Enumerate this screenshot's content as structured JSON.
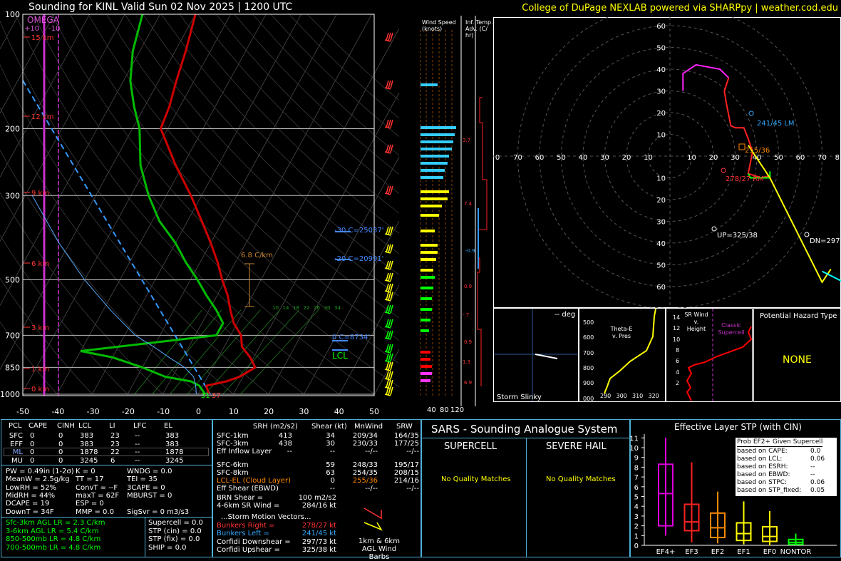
{
  "header": {
    "title": "Sounding for KINL Valid  Sun 02 Nov 2025 | 1200 UTC",
    "credit": "College of DuPage NEXLAB powered via SHARPpy | weather.cod.edu"
  },
  "skewt": {
    "omega_label": "OMEGA",
    "omega_scale": [
      "+10",
      "-10"
    ],
    "pressure_ticks": [
      "100",
      "200",
      "300",
      "500",
      "700",
      "850",
      "1000"
    ],
    "temp_ticks": [
      "-50",
      "-40",
      "-30",
      "-20",
      "-10",
      "0",
      "10",
      "20",
      "30",
      "40",
      "50"
    ],
    "height_labels": [
      "15 km",
      "12 km",
      "9 km",
      "6 km",
      "3 km",
      "1 km",
      "0 km"
    ],
    "lapse_label": "6.8 C/km",
    "levels": [
      "-30 C=25037'",
      "-20 C=20991'",
      "0 C=8734'"
    ],
    "lcl_label": "LCL",
    "sfc_td": "31",
    "sfc_t": "37",
    "mixing_ratio_labels": [
      "10",
      "14",
      "18",
      "22",
      "26",
      "30",
      "34"
    ]
  },
  "chart_data": [
    {
      "type": "line",
      "title": "Sounding for KINL Valid  Sun 02 Nov 2025 | 1200 UTC",
      "xlabel": "",
      "ylabel": "",
      "ylim": [
        1000,
        100
      ],
      "xlim": [
        -50,
        50
      ],
      "series": [
        {
          "name": "",
          "color": "#cc0000",
          "points": [
            [
              1000,
              3
            ],
            [
              950,
              1
            ],
            [
              925,
              6
            ],
            [
              900,
              9
            ],
            [
              850,
              12
            ],
            [
              800,
              9
            ],
            [
              750,
              5
            ],
            [
              700,
              3
            ],
            [
              650,
              -1
            ],
            [
              600,
              -4
            ],
            [
              550,
              -7
            ],
            [
              500,
              -11
            ],
            [
              450,
              -15
            ],
            [
              400,
              -20
            ],
            [
              350,
              -26
            ],
            [
              300,
              -33
            ],
            [
              250,
              -42
            ],
            [
              200,
              -52
            ],
            [
              175,
              -53
            ],
            [
              150,
              -55
            ],
            [
              125,
              -57
            ],
            [
              100,
              -60
            ]
          ]
        },
        {
          "name": "",
          "color": "#00bb00",
          "points": [
            [
              1000,
              2
            ],
            [
              950,
              -1
            ],
            [
              925,
              -4
            ],
            [
              900,
              -12
            ],
            [
              850,
              -20
            ],
            [
              800,
              -30
            ],
            [
              770,
              -40
            ],
            [
              700,
              -4
            ],
            [
              650,
              -4
            ],
            [
              600,
              -8
            ],
            [
              550,
              -13
            ],
            [
              500,
              -18
            ],
            [
              450,
              -24
            ],
            [
              400,
              -30
            ],
            [
              350,
              -38
            ],
            [
              300,
              -45
            ],
            [
              250,
              -52
            ],
            [
              200,
              -58
            ],
            [
              175,
              -63
            ],
            [
              150,
              -68
            ],
            [
              125,
              -72
            ],
            [
              100,
              -75
            ]
          ]
        },
        {
          "name": "",
          "color": "#55aaff",
          "points": [
            [
              1000,
              -0.5
            ],
            [
              950,
              -2
            ],
            [
              900,
              -4
            ],
            [
              850,
              -8
            ],
            [
              800,
              -14
            ],
            [
              750,
              -20
            ],
            [
              700,
              -27
            ],
            [
              600,
              -38
            ],
            [
              500,
              -50
            ],
            [
              400,
              -63
            ],
            [
              300,
              -78
            ]
          ]
        }
      ]
    },
    {
      "type": "line",
      "title": "",
      "xlabel": "",
      "ylabel": "",
      "xlim": [
        -70,
        80
      ],
      "ylim": [
        -65,
        65
      ],
      "rings": [
        "10",
        "20",
        "30",
        "40",
        "50",
        "60"
      ],
      "x_ticks": [
        "0",
        "70",
        "60",
        "50",
        "40",
        "30",
        "20",
        "10",
        "10",
        "20",
        "30",
        "40",
        "50",
        "60",
        "70",
        "8"
      ],
      "series": [
        {
          "name": "",
          "color": "#ffff00",
          "points": [
            [
              36,
              5
            ],
            [
              46,
              -10
            ],
            [
              60,
              -38
            ],
            [
              70,
              -58
            ]
          ]
        }
      ],
      "markers": {
        "lm": "241/45 LM",
        "rm": "278/27 RM",
        "mean": "255/36",
        "up": "UP=325/38",
        "dn": "DN=297/"
      }
    },
    {
      "type": "bar",
      "title": "Effective Layer STP (with CIN)",
      "categories": [
        "EF4+",
        "EF3",
        "EF2",
        "EF1",
        "EF0",
        "NONTOR"
      ],
      "ylim": [
        0,
        11
      ],
      "y_ticks": [
        "0",
        "1",
        "2",
        "3",
        "4",
        "5",
        "6",
        "7",
        "8",
        "9",
        "10",
        "11"
      ],
      "series": [
        {
          "name": "",
          "values": [
            5.3,
            2.4,
            1.8,
            1.2,
            0.9,
            0.3
          ]
        }
      ],
      "boxes": [
        [
          1,
          2,
          5.3,
          8.3,
          11
        ],
        [
          0.3,
          1.5,
          2.4,
          4.2,
          8.5
        ],
        [
          0.2,
          0.8,
          1.8,
          3.3,
          5.5
        ],
        [
          0.1,
          0.5,
          1.2,
          2.3,
          4.5
        ],
        [
          0,
          0.4,
          0.9,
          1.9,
          3.5
        ],
        [
          0,
          0.1,
          0.3,
          0.6,
          1.2
        ]
      ],
      "colors": [
        "#dd00dd",
        "#ff2222",
        "#ff8800",
        "#ffff00",
        "#ffee00",
        "#00ff00"
      ]
    }
  ],
  "narrow": {
    "wind_speed_title": "Wind Speed (knots)",
    "wind_ticks": [
      "40",
      "80",
      "120"
    ],
    "inf_title": "Inf. Temp. Adv. (C/ hr)",
    "inf_values": [
      "3.7",
      "7.4",
      "-0.9",
      "0.9",
      "-.7",
      "0.9",
      "1.3",
      "6.9"
    ]
  },
  "mini": {
    "slinky_label": "Storm Slinky",
    "slinky_deg": "-- deg",
    "theta_title": "Theta-E v. Pres",
    "theta_y": [
      "500",
      "600",
      "700",
      "800",
      "900",
      "000"
    ],
    "theta_x": [
      "290",
      "300",
      "310",
      "320"
    ],
    "srwind_title": "SR Wind v. Height",
    "srwind_y": [
      "14",
      "12",
      "10",
      "8",
      "6",
      "4",
      "2"
    ],
    "classic": "Classic Supercell",
    "hazard_title": "Potential Hazard Type",
    "hazard_value": "NONE"
  },
  "parcels": {
    "headers": [
      "PCL",
      "CAPE",
      "CINH",
      "LCL",
      "LI",
      "LFC",
      "EL"
    ],
    "rows": [
      [
        "SFC",
        "0",
        "0",
        "383",
        "23",
        "--",
        "383"
      ],
      [
        "EFF",
        "0",
        "0",
        "383",
        "23",
        "--",
        "383"
      ],
      [
        "ML",
        "0",
        "0",
        "1878",
        "22",
        "--",
        "1878"
      ],
      [
        "MU",
        "0",
        "0",
        "3245",
        "6",
        "--",
        "3245"
      ]
    ]
  },
  "indices": [
    [
      "PW = 0.49in (1-2σ)",
      "K = 0",
      "WNDG = 0.0"
    ],
    [
      "MeanW = 2.5g/kg",
      "TT = 17",
      "TEI = 35"
    ],
    [
      "LowRH = 52%",
      "ConvT = --F",
      "3CAPE = 0"
    ],
    [
      "MidRH = 44%",
      "maxT = 62F",
      "MBURST = 0"
    ],
    [
      "DCAPE = 19",
      "ESP = 0",
      ""
    ],
    [
      "DownT = 34F",
      "MMP = 0.0",
      "SigSvr = 0 m3/s3"
    ]
  ],
  "lapse": [
    "Sfc-3km AGL LR = 2.3 C/km",
    "3-6km AGL LR = 5.4 C/km",
    "850-500mb LR = 4.8 C/km",
    "700-500mb LR = 4.8 C/km"
  ],
  "comp": [
    "Supercell = 0.0",
    "STP (cin) = 0.0",
    "STP (fix) = 0.0",
    "SHIP = 0.0"
  ],
  "kin": {
    "headers": [
      "SRH (m2/s2)",
      "Shear (kt)",
      "MnWind",
      "SRW"
    ],
    "rows": [
      [
        "SFC-1km",
        "413",
        "34",
        "209/34",
        "164/35"
      ],
      [
        "SFC-3km",
        "438",
        "30",
        "230/33",
        "177/25"
      ],
      [
        "Eff Inflow Layer",
        "--",
        "--",
        "--/--",
        "--/--"
      ],
      [
        "",
        ""
      ],
      [
        "SFC-6km",
        "59",
        "248/33",
        "195/17"
      ],
      [
        "SFC-8km",
        "63",
        "254/35",
        "208/15"
      ],
      [
        "LCL-EL (Cloud Layer)",
        "0",
        "255/36",
        "214/16"
      ],
      [
        "Eff Shear (EBWD)",
        "--",
        "--/--",
        "--/--"
      ]
    ],
    "brn_shear": "BRN Shear =",
    "brn_shear_v": "100 m2/s2",
    "sr_wind": "4-6km SR Wind =",
    "sr_wind_v": "284/16 kt",
    "storm_title": "...Storm Motion Vectors...",
    "storm": [
      [
        "Bunkers Right =",
        "278/27 kt"
      ],
      [
        "Bunkers Left =",
        "241/45 kt"
      ],
      [
        "Corfidi Downshear =",
        "297/73 kt"
      ],
      [
        "Corfidi Upshear =",
        "325/38 kt"
      ]
    ],
    "barb_label": "1km & 6km AGL Wind Barbs"
  },
  "sars": {
    "title": "SARS - Sounding Analogue System",
    "supercell": "SUPERCELL",
    "hail": "SEVERE HAIL",
    "sup_msg": "No Quality Matches",
    "hail_msg": "No Quality Matches"
  },
  "stp_box": {
    "title": "Prob EF2+ Given Supercell",
    "rows": [
      [
        "based on CAPE:",
        "0.0"
      ],
      [
        "based on LCL:",
        "0.06"
      ],
      [
        "based on ESRH:",
        "--"
      ],
      [
        "based on EBWD:",
        "--"
      ],
      [
        "based on STPC:",
        "0.06"
      ],
      [
        "based on STP_fixed:",
        "0.05"
      ]
    ]
  }
}
